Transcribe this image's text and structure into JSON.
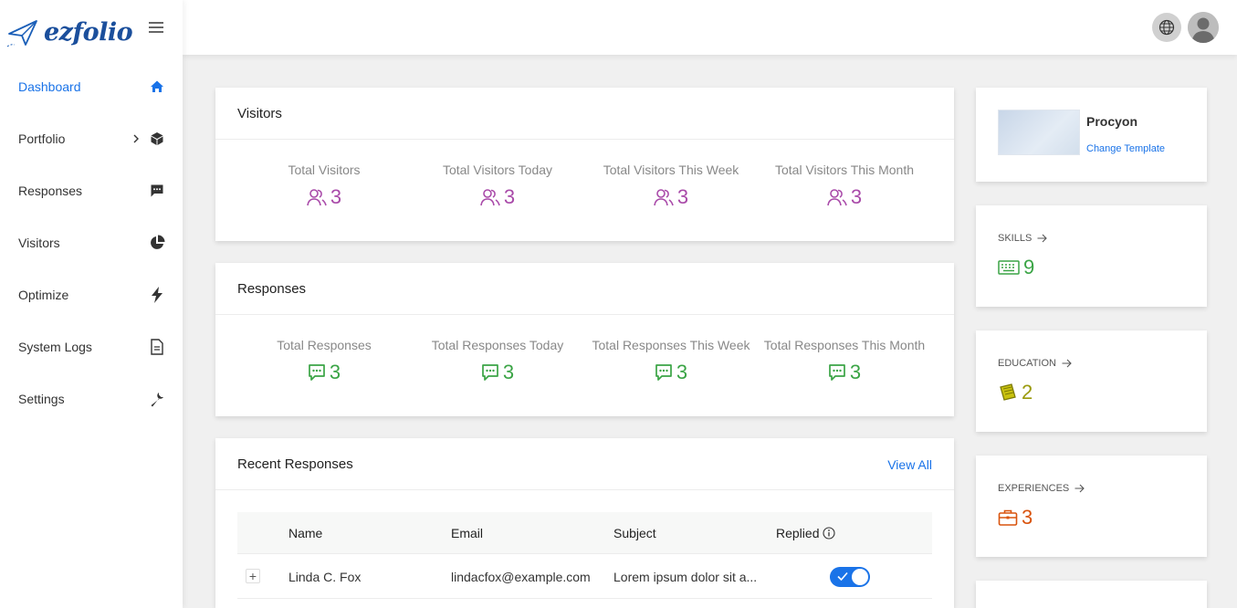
{
  "app": {
    "logo_text": "ezfolio"
  },
  "sidebar": {
    "items": [
      {
        "label": "Dashboard",
        "icon": "home-icon"
      },
      {
        "label": "Portfolio",
        "icon": "cube-icon"
      },
      {
        "label": "Responses",
        "icon": "message-icon"
      },
      {
        "label": "Visitors",
        "icon": "pie-chart-icon"
      },
      {
        "label": "Optimize",
        "icon": "bolt-icon"
      },
      {
        "label": "System Logs",
        "icon": "file-icon"
      },
      {
        "label": "Settings",
        "icon": "wrench-icon"
      }
    ]
  },
  "visitors": {
    "title": "Visitors",
    "stats": [
      {
        "label": "Total Visitors",
        "value": "3"
      },
      {
        "label": "Total Visitors Today",
        "value": "3"
      },
      {
        "label": "Total Visitors This Week",
        "value": "3"
      },
      {
        "label": "Total Visitors This Month",
        "value": "3"
      }
    ]
  },
  "responses": {
    "title": "Responses",
    "stats": [
      {
        "label": "Total Responses",
        "value": "3"
      },
      {
        "label": "Total Responses Today",
        "value": "3"
      },
      {
        "label": "Total Responses This Week",
        "value": "3"
      },
      {
        "label": "Total Responses This Month",
        "value": "3"
      }
    ]
  },
  "recent": {
    "title": "Recent Responses",
    "view_all": "View All",
    "columns": [
      "Name",
      "Email",
      "Subject",
      "Replied"
    ],
    "rows": [
      {
        "expand": "+",
        "name": "Linda C. Fox",
        "email": "lindacfox@example.com",
        "subject": "Lorem ipsum dolor sit a...",
        "replied": true
      }
    ]
  },
  "template": {
    "name": "Procyon",
    "link": "Change Template"
  },
  "summary": {
    "skills": {
      "label": "SKILLS",
      "value": "9"
    },
    "education": {
      "label": "EDUCATION",
      "value": "2"
    },
    "experiences": {
      "label": "EXPERIENCES",
      "value": "3"
    }
  },
  "colors": {
    "accent": "#1a73e8",
    "visitors": "#a94aa9",
    "responses": "#3aa445",
    "skills": "#3aa445",
    "education": "#9a9a0c",
    "experiences": "#d9540e"
  }
}
